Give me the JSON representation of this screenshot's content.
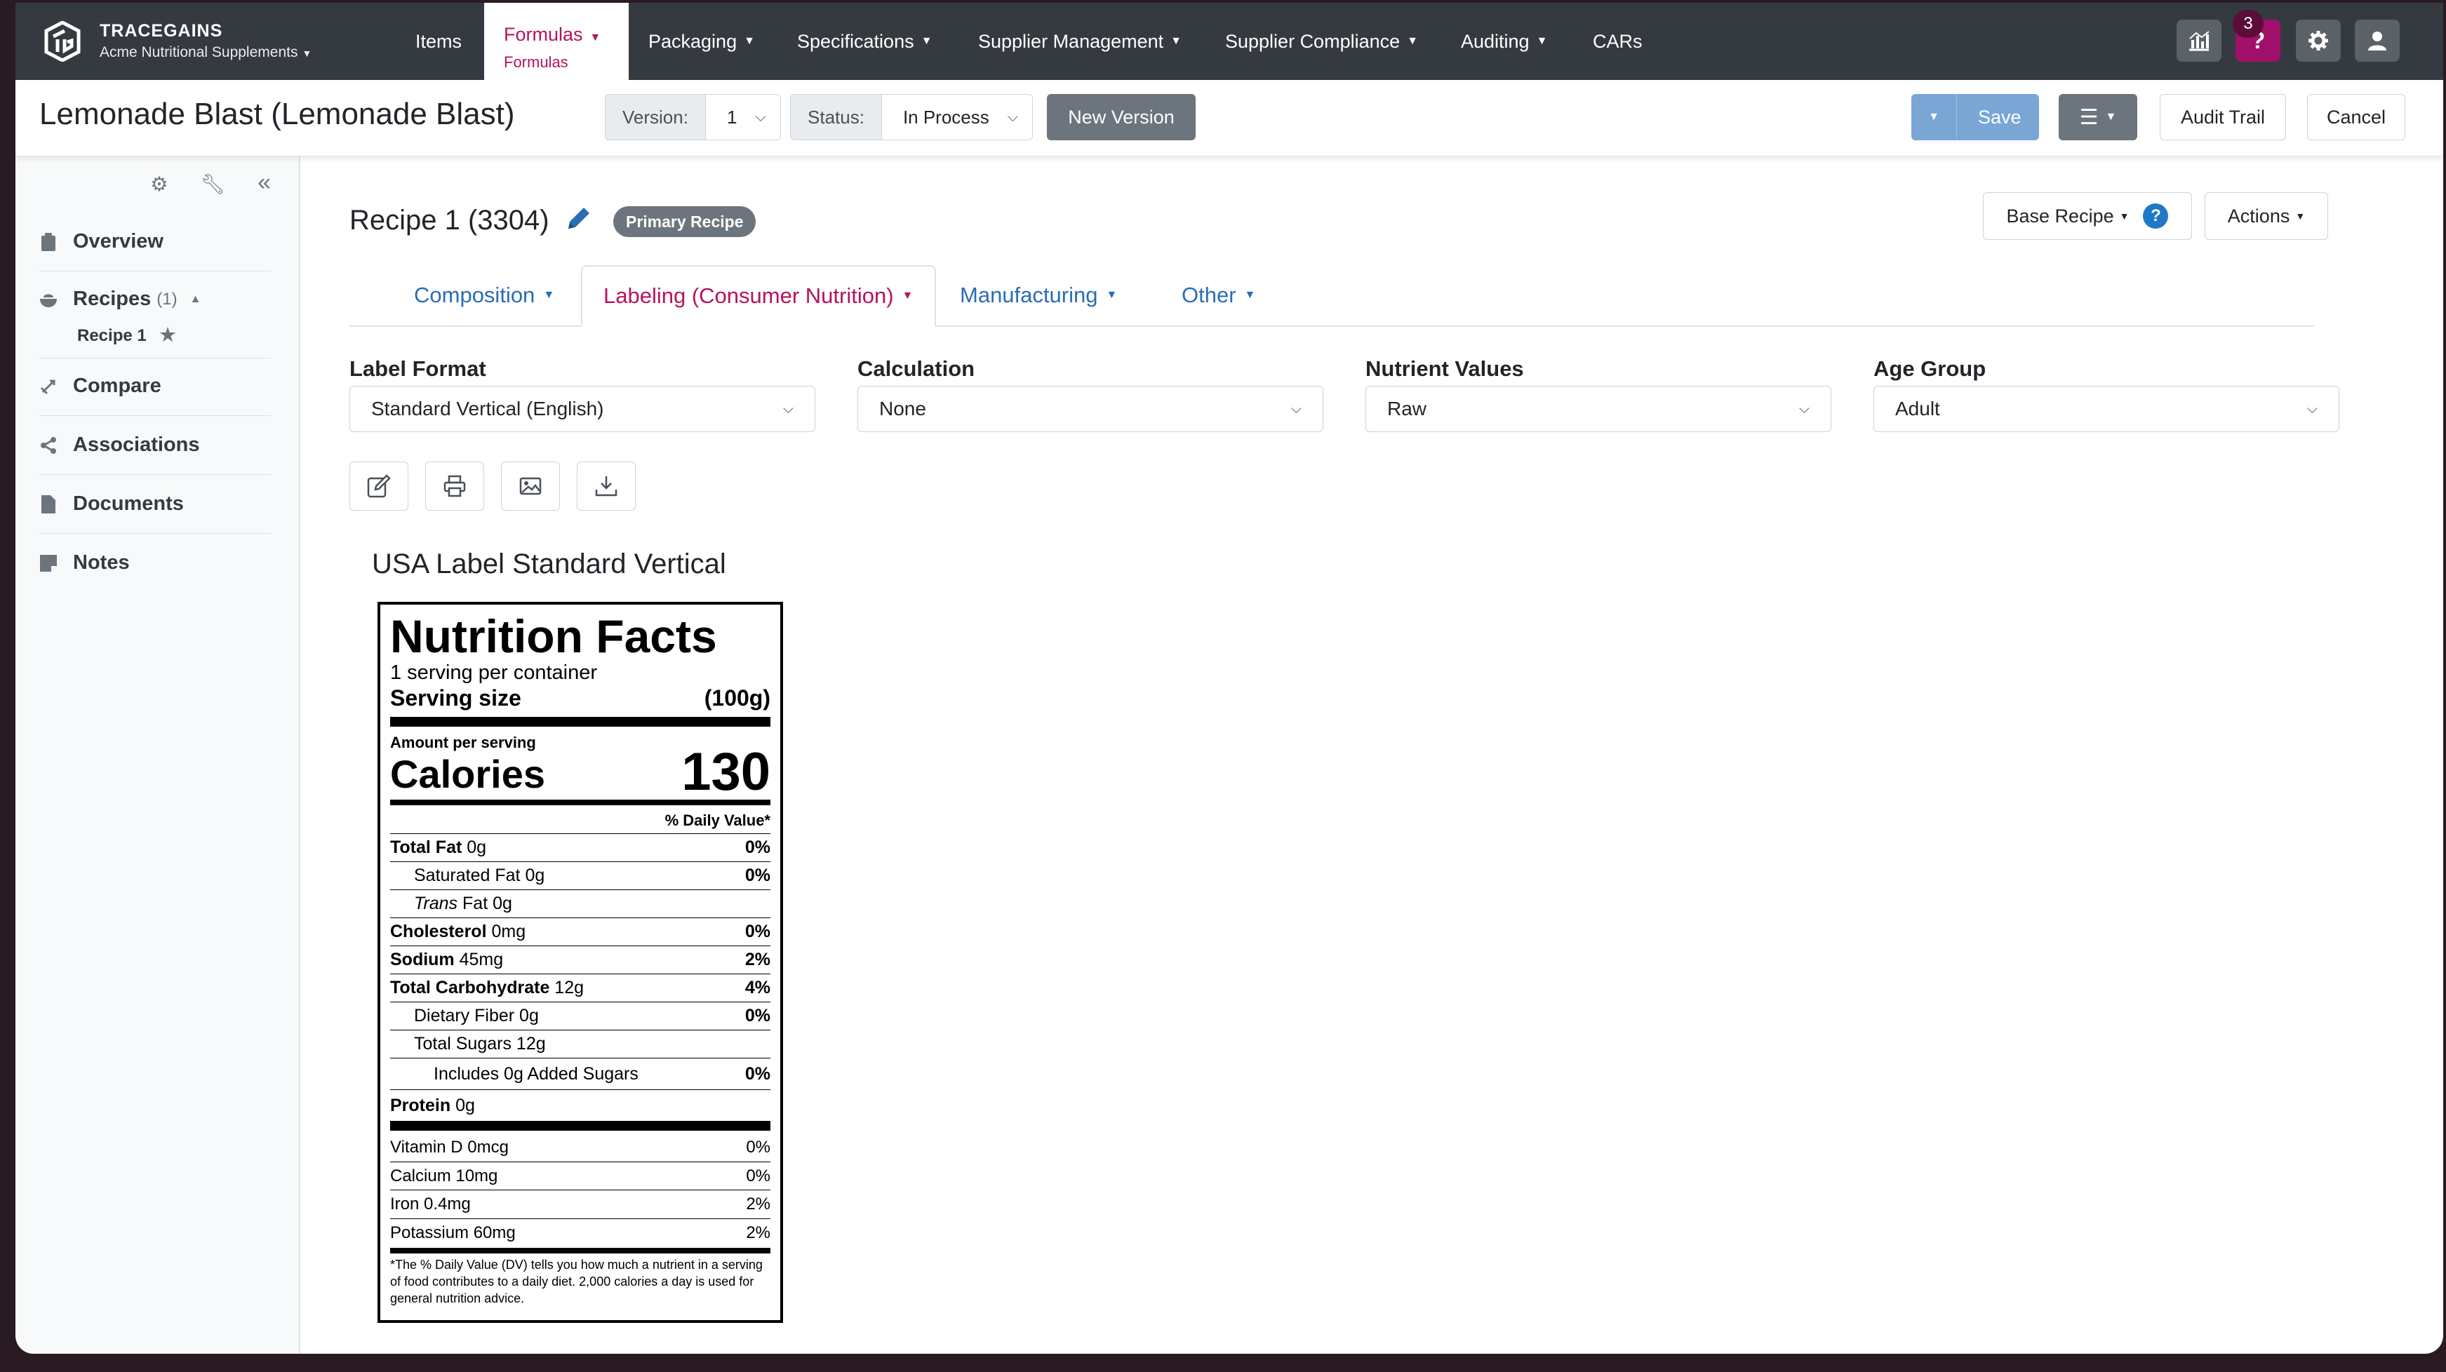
{
  "brand": {
    "name": "TRACEGAINS",
    "company": "Acme Nutritional Supplements"
  },
  "nav": {
    "items": [
      {
        "label": "Items"
      },
      {
        "label": "Formulas",
        "sub": "Formulas"
      },
      {
        "label": "Packaging"
      },
      {
        "label": "Specifications"
      },
      {
        "label": "Supplier Management"
      },
      {
        "label": "Supplier Compliance"
      },
      {
        "label": "Auditing"
      },
      {
        "label": "CARs"
      }
    ],
    "notification_count": "3",
    "help_label": "?"
  },
  "header": {
    "title": "Lemonade Blast (Lemonade Blast)",
    "version_label": "Version:",
    "version_value": "1",
    "status_label": "Status:",
    "status_value": "In Process",
    "new_version": "New Version",
    "save": "Save",
    "audit_trail": "Audit Trail",
    "cancel": "Cancel"
  },
  "sidebar": {
    "items": [
      {
        "label": "Overview",
        "icon": "clipboard-icon"
      },
      {
        "label": "Recipes",
        "count": "(1)",
        "icon": "bowl-icon"
      },
      {
        "label": "Compare",
        "icon": "compare-icon"
      },
      {
        "label": "Associations",
        "icon": "share-icon"
      },
      {
        "label": "Documents",
        "icon": "document-icon"
      },
      {
        "label": "Notes",
        "icon": "note-icon"
      }
    ],
    "recipe_sub": "Recipe 1"
  },
  "recipe": {
    "title": "Recipe 1 (3304)",
    "badge": "Primary Recipe",
    "base_recipe": "Base Recipe",
    "actions": "Actions"
  },
  "tabs": [
    {
      "label": "Composition"
    },
    {
      "label": "Labeling (Consumer Nutrition)"
    },
    {
      "label": "Manufacturing"
    },
    {
      "label": "Other"
    }
  ],
  "filters": {
    "label_format": {
      "label": "Label Format",
      "value": "Standard Vertical (English)"
    },
    "calculation": {
      "label": "Calculation",
      "value": "None"
    },
    "nutrient_values": {
      "label": "Nutrient Values",
      "value": "Raw"
    },
    "age_group": {
      "label": "Age Group",
      "value": "Adult"
    }
  },
  "label_heading": "USA Label Standard Vertical",
  "nutrition": {
    "title": "Nutrition Facts",
    "servings": "1 serving per container",
    "serving_size_label": "Serving size",
    "serving_size_value": "(100g)",
    "amount_per_serving": "Amount per serving",
    "calories_label": "Calories",
    "calories_value": "130",
    "dv_header": "% Daily Value*",
    "rows": [
      {
        "name": "Total Fat",
        "amount": "0g",
        "dv": "0%"
      },
      {
        "name": "Saturated Fat",
        "amount": "0g",
        "dv": "0%"
      },
      {
        "name": "Trans",
        "amount": "Fat 0g",
        "dv": ""
      },
      {
        "name": "Cholesterol",
        "amount": "0mg",
        "dv": "0%"
      },
      {
        "name": "Sodium",
        "amount": "45mg",
        "dv": "2%"
      },
      {
        "name": "Total Carbohydrate",
        "amount": "12g",
        "dv": "4%"
      },
      {
        "name": "Dietary Fiber",
        "amount": "0g",
        "dv": "0%"
      },
      {
        "name": "Total Sugars",
        "amount": "12g",
        "dv": ""
      },
      {
        "name": "Includes 0g Added Sugars",
        "amount": "",
        "dv": "0%"
      },
      {
        "name": "Protein",
        "amount": "0g",
        "dv": ""
      }
    ],
    "vitamins": [
      {
        "name": "Vitamin D 0mcg",
        "dv": "0%"
      },
      {
        "name": "Calcium 10mg",
        "dv": "0%"
      },
      {
        "name": "Iron 0.4mg",
        "dv": "2%"
      },
      {
        "name": "Potassium 60mg",
        "dv": "2%"
      }
    ],
    "footnote": "*The % Daily Value (DV) tells you how much a nutrient in a serving of food contributes to a daily diet. 2,000 calories a day is used for general nutrition advice."
  },
  "colors": {
    "accent": "#b5135f",
    "link": "#2a6db5",
    "nav_bg": "#343a40"
  }
}
